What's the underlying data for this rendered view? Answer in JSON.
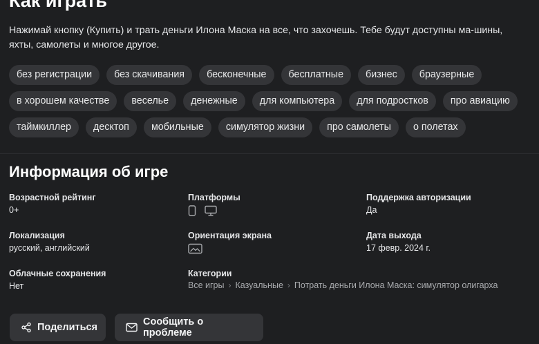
{
  "howto": {
    "title": "Как играть",
    "text": "Нажимай кнопку (Купить) и трать деньги Илона Маска на все, что захочешь. Тебе будут доступны ма-шины, яхты, самолеты и многое другое."
  },
  "tags": [
    "без регистрации",
    "без скачивания",
    "бесконечные",
    "бесплатные",
    "бизнес",
    "браузерные",
    "в хорошем качестве",
    "веселье",
    "денежные",
    "для компьютера",
    "для подростков",
    "про авиацию",
    "таймкиллер",
    "десктоп",
    "мобильные",
    "симулятор жизни",
    "про самолеты",
    "о полетах"
  ],
  "info": {
    "title": "Информация об игре",
    "age_label": "Возрастной рейтинг",
    "age_value": "0+",
    "platforms_label": "Платформы",
    "platform_icons": [
      "mobile-icon",
      "desktop-icon"
    ],
    "auth_label": "Поддержка авторизации",
    "auth_value": "Да",
    "locale_label": "Локализация",
    "locale_value": "русский, английский",
    "orientation_label": "Ориентация экрана",
    "orientation_icon": "landscape-icon",
    "release_label": "Дата выхода",
    "release_value": "17 февр. 2024 г.",
    "cloud_label": "Облачные сохранения",
    "cloud_value": "Нет",
    "categories_label": "Категории",
    "breadcrumbs": [
      "Все игры",
      "Казуальные",
      "Потрать деньги Илона Маска: симулятор олигарха"
    ]
  },
  "actions": {
    "share_label": "Поделиться",
    "report_label": "Сообщить о проблеме"
  }
}
